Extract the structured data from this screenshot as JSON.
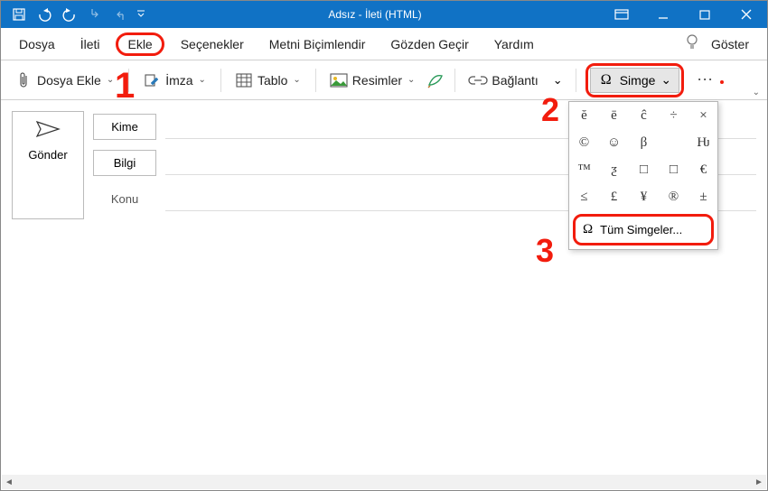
{
  "titlebar": {
    "title": "Adsız  -  İleti (HTML)"
  },
  "tabs": {
    "file": "Dosya",
    "message": "İleti",
    "insert": "Ekle",
    "options": "Seçenekler",
    "format": "Metni Biçimlendir",
    "review": "Gözden Geçir",
    "help": "Yardım",
    "show": "Göster"
  },
  "ribbon": {
    "attach": "Dosya Ekle",
    "signature": "İmza",
    "table": "Tablo",
    "pictures": "Resimler",
    "link": "Bağlantı",
    "symbol": "Simge"
  },
  "compose": {
    "send": "Gönder",
    "to": "Kime",
    "cc": "Bilgi",
    "subject": "Konu"
  },
  "symbols": {
    "grid": [
      [
        "ĕ",
        "ē",
        "ĉ",
        "÷",
        "×"
      ],
      [
        "©",
        "☺",
        "β",
        "",
        "Ƕ"
      ],
      [
        "™",
        "ƺ",
        "□",
        "□",
        "€"
      ],
      [
        "≤",
        "£",
        "¥",
        "®",
        "±"
      ]
    ],
    "all": "Tüm Simgeler..."
  },
  "annotations": {
    "one": "1",
    "two": "2",
    "three": "3"
  }
}
